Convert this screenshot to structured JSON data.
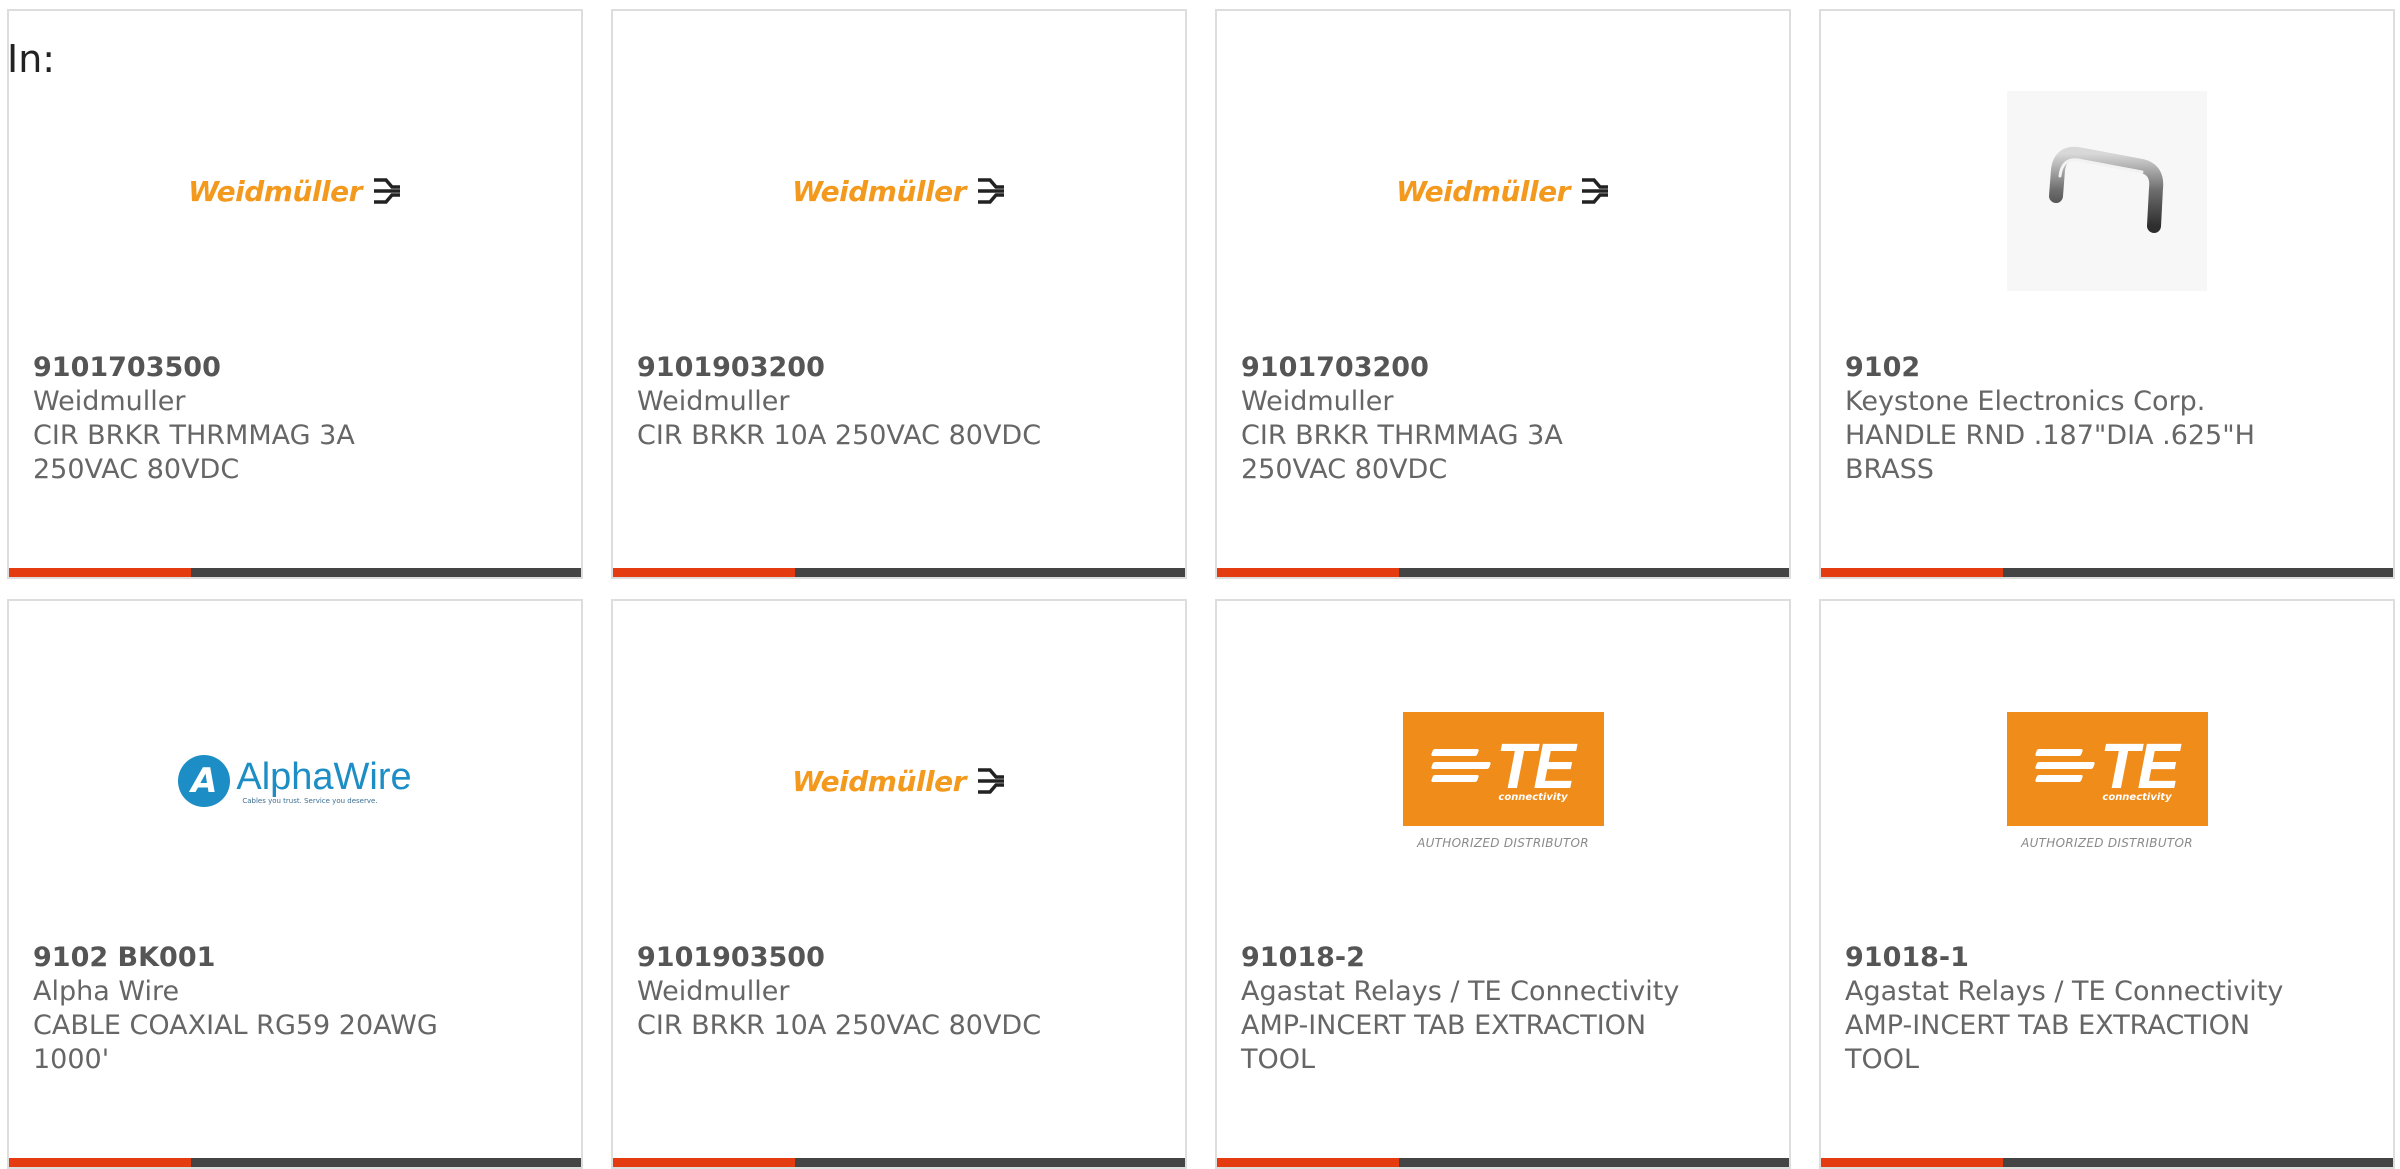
{
  "header": {
    "in_label": "In:"
  },
  "colors": {
    "accent_orange": "#e53b10",
    "bar_dark": "#444444",
    "weidmuller_orange": "#f39a1e",
    "te_orange": "#f08c1a",
    "alphawire_blue": "#1d8ec5"
  },
  "cards": [
    {
      "part_number": "9101703500",
      "manufacturer": "Weidmuller",
      "description": "CIR BRKR THRMMAG 3A 250VAC 80VDC",
      "image": {
        "type": "weidmuller-logo",
        "word": "Weidmüller"
      }
    },
    {
      "part_number": "9101903200",
      "manufacturer": "Weidmuller",
      "description": "CIR BRKR 10A 250VAC 80VDC",
      "image": {
        "type": "weidmuller-logo",
        "word": "Weidmüller"
      }
    },
    {
      "part_number": "9101703200",
      "manufacturer": "Weidmuller",
      "description": "CIR BRKR THRMMAG 3A 250VAC 80VDC",
      "image": {
        "type": "weidmuller-logo",
        "word": "Weidmüller"
      }
    },
    {
      "part_number": "9102",
      "manufacturer": "Keystone Electronics Corp.",
      "description": "HANDLE RND .187\"DIA .625\"H BRASS",
      "image": {
        "type": "handle-photo"
      }
    },
    {
      "part_number": "9102 BK001",
      "manufacturer": "Alpha Wire",
      "description": "CABLE COAXIAL RG59 20AWG 1000'",
      "image": {
        "type": "alphawire-logo",
        "word": "AlphaWire",
        "tagline": "Cables you trust. Service you deserve."
      }
    },
    {
      "part_number": "9101903500",
      "manufacturer": "Weidmuller",
      "description": "CIR BRKR 10A 250VAC 80VDC",
      "image": {
        "type": "weidmuller-logo",
        "word": "Weidmüller"
      }
    },
    {
      "part_number": "91018-2",
      "manufacturer": "Agastat Relays / TE Connectivity",
      "description": "AMP-INCERT TAB EXTRACTION TOOL",
      "image": {
        "type": "te-logo",
        "word": "TE",
        "sub": "connectivity",
        "caption": "AUTHORIZED DISTRIBUTOR"
      }
    },
    {
      "part_number": "91018-1",
      "manufacturer": "Agastat Relays / TE Connectivity",
      "description": "AMP-INCERT TAB EXTRACTION TOOL",
      "image": {
        "type": "te-logo",
        "word": "TE",
        "sub": "connectivity",
        "caption": "AUTHORIZED DISTRIBUTOR"
      }
    }
  ]
}
